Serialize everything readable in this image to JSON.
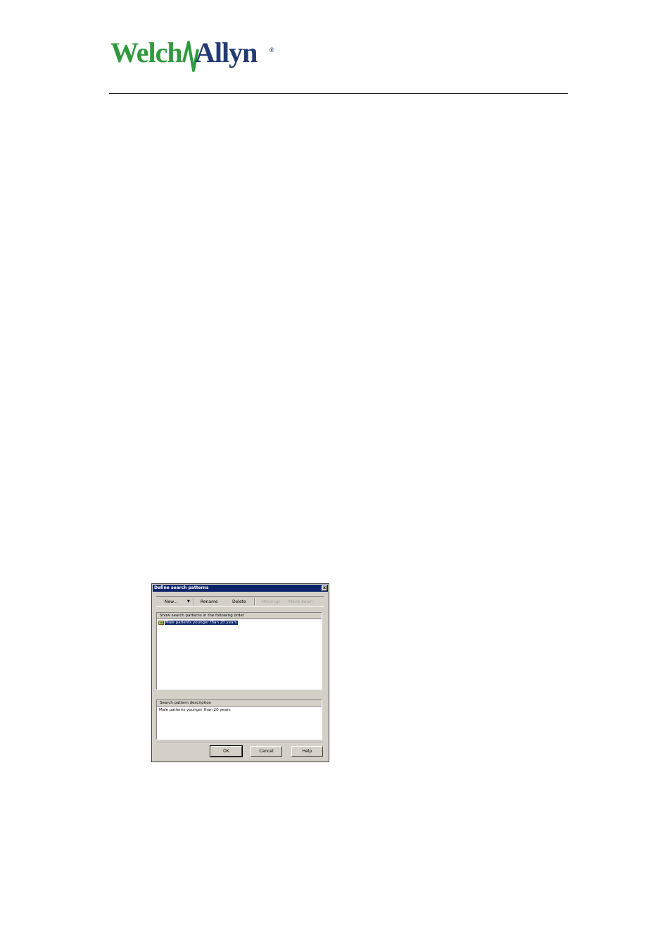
{
  "logo": {
    "text": "WelchAllyn",
    "registered_mark": "®"
  },
  "dialog": {
    "title": "Define search patterns",
    "close_label": "x",
    "toolbar": {
      "new_label": "New...",
      "new_dropdown_icon": "dropdown-arrow-icon",
      "rename_label": "Rename",
      "delete_label": "Delete",
      "move_up_label": "Move up",
      "move_down_label": "Move down"
    },
    "patterns_header": "Show search patterns in the following order",
    "patterns": [
      {
        "label": "Male patients younger than 20 years",
        "icon": "folder-icon",
        "selected": true
      }
    ],
    "description_header": "Search pattern description",
    "description_text": "Male patients younger than 20 years",
    "buttons": {
      "ok": "OK",
      "cancel": "Cancel",
      "help": "Help"
    }
  },
  "colors": {
    "logo_green": "#2f9a3e",
    "logo_navy": "#233a73",
    "selection": "#0a246a",
    "dialog_face": "#d4d0c8"
  }
}
